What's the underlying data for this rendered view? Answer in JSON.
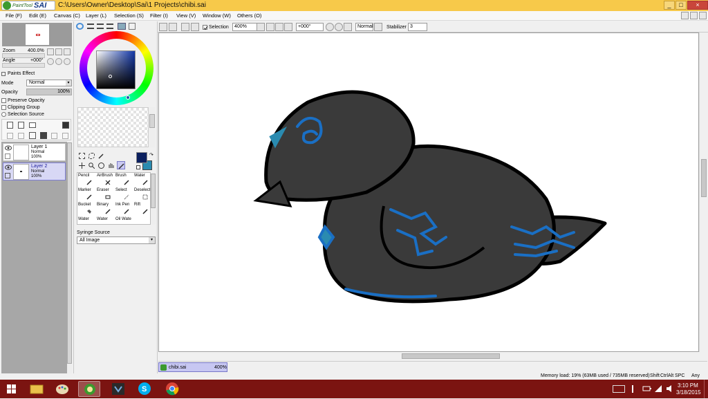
{
  "window": {
    "logo_small": "PaintTool",
    "logo_big": "SAI",
    "title": "C:\\Users\\Owner\\Desktop\\Sai\\1 Projects\\chibi.sai",
    "controls": [
      "_",
      "□",
      "×"
    ]
  },
  "menu": [
    "File (F)",
    "Edit (E)",
    "Canvas (C)",
    "Layer (L)",
    "Selection (S)",
    "Filter (I)",
    "View (V)",
    "Window (W)",
    "Others (O)"
  ],
  "navigator": {
    "zoom_label": "Zoom",
    "zoom_value": "400.0%",
    "angle_label": "Angle",
    "angle_value": "+000°"
  },
  "layer_props": {
    "paint_effect": "Paints Effect",
    "mode_label": "Mode",
    "mode_value": "Normal",
    "opacity_label": "Opacity",
    "opacity_value": "100%",
    "preserve_opacity": "Preserve Opacity",
    "clipping_group": "Clipping Group",
    "selection_source": "Selection Source"
  },
  "layers": [
    {
      "name": "Layer 1",
      "mode": "Normal",
      "opacity": "100%"
    },
    {
      "name": "Layer 2",
      "mode": "Normal",
      "opacity": "100%"
    }
  ],
  "tools": [
    {
      "label": "Pencil"
    },
    {
      "label": "AirBrush"
    },
    {
      "label": "Brush"
    },
    {
      "label": "Water"
    },
    {
      "label": "Marker"
    },
    {
      "label": "Eraser"
    },
    {
      "label": "Select"
    },
    {
      "label": "Deselect"
    },
    {
      "label": "Bucket"
    },
    {
      "label": "Binary"
    },
    {
      "label": "Ink Pen"
    },
    {
      "label": "Rift"
    },
    {
      "label": "Water"
    },
    {
      "label": "Water"
    },
    {
      "label": "Oil Wate"
    }
  ],
  "syringe": {
    "label": "Syringe Source",
    "value": "All Image"
  },
  "colors": {
    "primary": "#0b1f5e",
    "secondary": "#2a8bb0",
    "bird_body": "#3a3a3a",
    "accent_blue": "#1a6fc4",
    "titlebar": "#f7c94a",
    "taskbar": "#7b1411"
  },
  "canvas_toolbar": {
    "selection_label": "Selection",
    "zoom": "400%",
    "angle": "+000°",
    "blend": "Normal",
    "stabilizer_label": "Stabilizer",
    "stabilizer_value": "3"
  },
  "document": {
    "tab_name": "chibi.sai",
    "tab_zoom": "400%"
  },
  "status": {
    "memory": "Memory load: 19% (63MB used / 735MB reserved)",
    "keys": [
      "Shift",
      "Ctrl",
      "Alt",
      "SPC",
      "Any"
    ]
  },
  "taskbar": {
    "time": "3:10 PM",
    "date": "3/18/2015",
    "icons": [
      "windows-icon",
      "file-explorer-icon",
      "paint-icon",
      "painttool-sai-icon",
      "steam-like-icon",
      "skype-icon",
      "chrome-icon"
    ]
  }
}
